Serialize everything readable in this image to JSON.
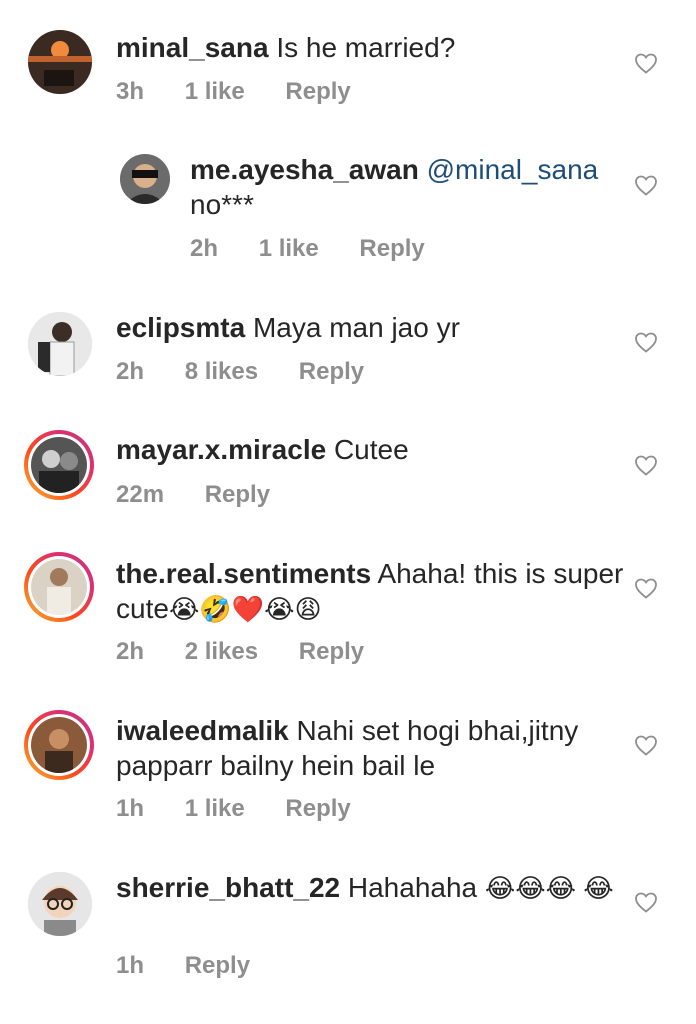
{
  "comments": [
    {
      "username": "minal_sana",
      "text": "Is he married?",
      "time": "3h",
      "likes": "1 like",
      "reply": "Reply"
    },
    {
      "username": "me.ayesha_awan",
      "mention": "@minal_sana",
      "text": "no***",
      "time": "2h",
      "likes": "1 like",
      "reply": "Reply"
    },
    {
      "username": "eclipsmta",
      "text": "Maya man jao yr",
      "time": "2h",
      "likes": "8 likes",
      "reply": "Reply"
    },
    {
      "username": "mayar.x.miracle",
      "text": "Cutee",
      "time": "22m",
      "reply": "Reply"
    },
    {
      "username": "the.real.sentiments",
      "text": "Ahaha! this is super cute",
      "emojis": "😭🤣❤️😭😩",
      "time": "2h",
      "likes": "2 likes",
      "reply": "Reply"
    },
    {
      "username": "iwaleedmalik",
      "text": "Nahi set hogi bhai,jitny papparr bailny hein bail le",
      "time": "1h",
      "likes": "1 like",
      "reply": "Reply"
    },
    {
      "username": "sherrie_bhatt_22",
      "text": "Hahahaha",
      "emojis": "😂😂😂 😂",
      "time": "1h",
      "reply": "Reply"
    }
  ],
  "icons": {
    "like": "heart-outline-icon"
  },
  "colors": {
    "text": "#262626",
    "meta": "#8e8e8e",
    "mention": "#1d4e7a"
  }
}
